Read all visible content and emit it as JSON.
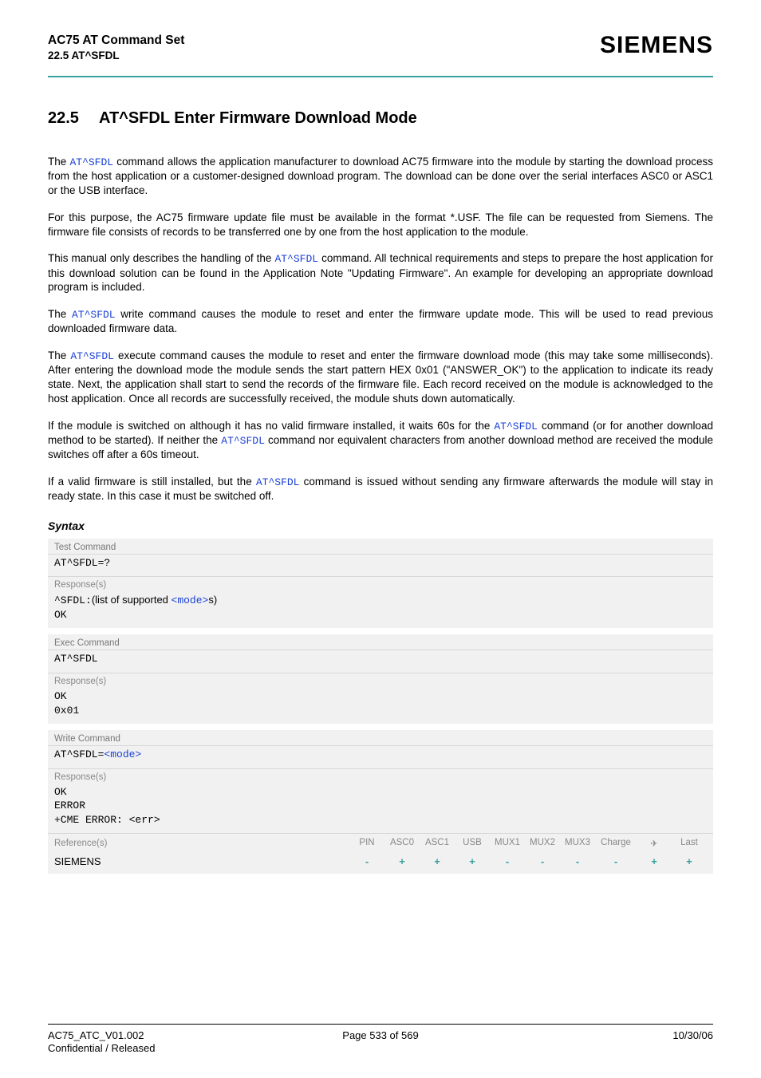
{
  "header": {
    "title_line1": "AC75 AT Command Set",
    "title_line2": "22.5 AT^SFDL",
    "logo": "SIEMENS"
  },
  "section": {
    "number": "22.5",
    "title": "AT^SFDL   Enter Firmware Download Mode"
  },
  "links": {
    "atsfdl": "AT^SFDL",
    "mode": "<mode>"
  },
  "paragraphs": {
    "p1_a": "The ",
    "p1_b": " command allows the application manufacturer to download AC75 firmware into the module by starting the download process from the host application or a customer-designed download program. The download can be done over the serial interfaces ASC0 or ASC1 or the USB interface.",
    "p2": "For this purpose, the AC75 firmware update file must be available in the format *.USF. The file can be requested from Siemens. The firmware file consists of records to be transferred one by one from the host application to the module.",
    "p3_a": "This manual only describes the handling of the ",
    "p3_b": " command. All technical requirements and steps to prepare the host application for this download solution can be found in the Application Note \"Updating Firmware\". An example for developing an appropriate download program is included.",
    "p4_a": "The ",
    "p4_b": " write command causes the module to reset and enter the firmware update mode. This will be used to read previous downloaded firmware data.",
    "p5_a": "The ",
    "p5_b": " execute command causes the module to reset and enter the firmware download mode (this may take some milliseconds). After entering the download mode the module sends the start pattern HEX 0x01 (\"ANSWER_OK\") to the application to indicate its ready state. Next, the application shall start to send the records of the firmware file. Each record received on the module is acknowledged to the host application. Once all records are successfully received, the module shuts down automatically.",
    "p6_a": "If the module is switched on although it has no valid firmware installed, it waits 60s for the ",
    "p6_b": " command (or for another download method to be started). If neither the ",
    "p6_c": " command nor equivalent characters from another download method are received the module switches off after a 60s timeout.",
    "p7_a": "If a valid firmware is still installed, but the ",
    "p7_b": " command is issued without sending any firmware afterwards the module will stay in ready state. In this case it must be switched off."
  },
  "syntax": {
    "heading": "Syntax",
    "test_label": "Test Command",
    "test_cmd": "AT^SFDL=?",
    "response_label": "Response(s)",
    "test_resp_prefix": "^SFDL:",
    "test_resp_mid": "(list of supported ",
    "test_resp_suffix": "s)",
    "ok": "OK",
    "exec_label": "Exec Command",
    "exec_cmd": "AT^SFDL",
    "exec_resp2": "0x01",
    "write_label": "Write Command",
    "write_cmd_prefix": "AT^SFDL=",
    "error": "ERROR",
    "cme": "+CME ERROR: <err>",
    "reference_label": "Reference(s)",
    "reference_value": "SIEMENS",
    "cols": [
      "PIN",
      "ASC0",
      "ASC1",
      "USB",
      "MUX1",
      "MUX2",
      "MUX3",
      "Charge",
      "✈",
      "Last"
    ],
    "vals": [
      "-",
      "+",
      "+",
      "+",
      "-",
      "-",
      "-",
      "-",
      "+",
      "+"
    ]
  },
  "footer": {
    "left1": "AC75_ATC_V01.002",
    "left2": "Confidential / Released",
    "center": "Page 533 of 569",
    "right": "10/30/06"
  }
}
